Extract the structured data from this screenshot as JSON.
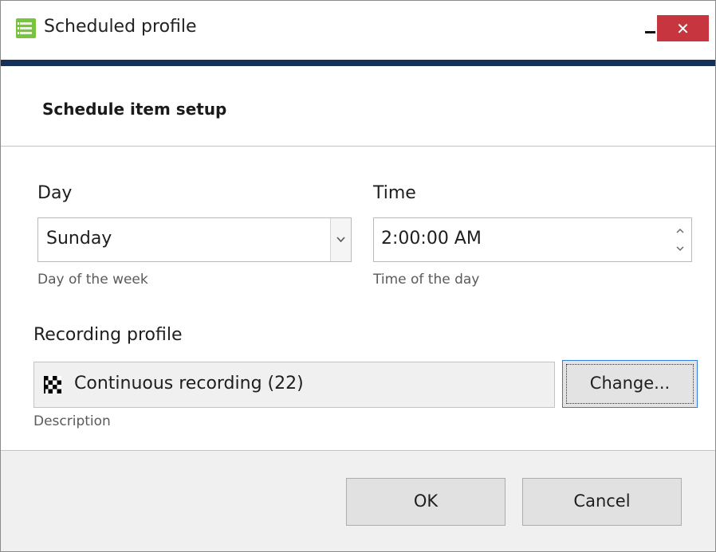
{
  "window": {
    "title": "Scheduled profile",
    "close_glyph": "✕",
    "app_icon": "schedule-list-icon",
    "accent_color": "#16305a",
    "close_color": "#c7353f"
  },
  "header": {
    "title": "Schedule item setup"
  },
  "day": {
    "label": "Day",
    "value": "Sunday",
    "helper": "Day of the week",
    "icon": "chevron-down-icon"
  },
  "time": {
    "label": "Time",
    "value": "2:00:00 AM",
    "helper": "Time of the day",
    "icons": [
      "spin-up-icon",
      "spin-down-icon"
    ]
  },
  "recording": {
    "label": "Recording profile",
    "value": "Continuous recording (22)",
    "helper": "Description",
    "icon": "checkered-flag-icon",
    "change_label": "Change..."
  },
  "footer": {
    "ok_label": "OK",
    "cancel_label": "Cancel"
  }
}
